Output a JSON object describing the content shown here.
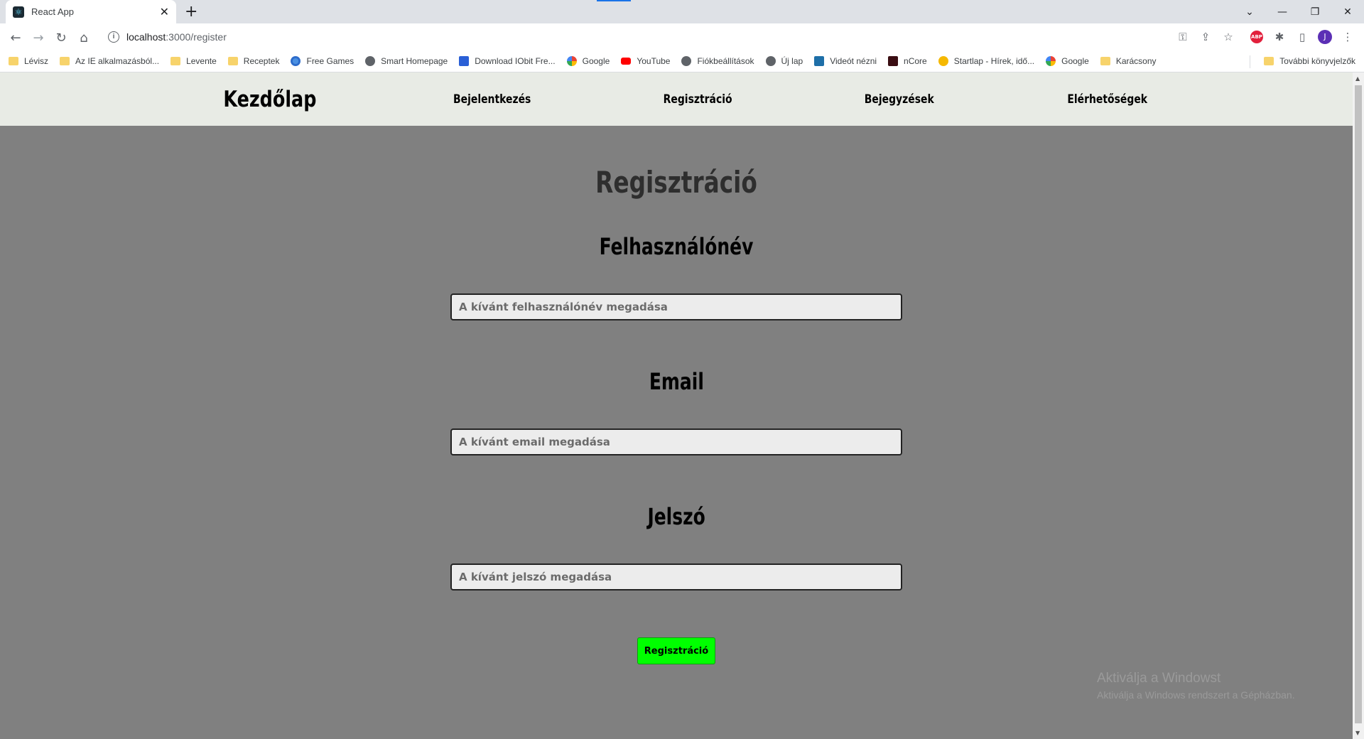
{
  "browser": {
    "tab": {
      "title": "React App",
      "close": "✕"
    },
    "new_tab": "+",
    "url_host": "localhost",
    "url_path": ":3000/register",
    "window_controls": {
      "dropdown": "⌄",
      "minimize": "—",
      "restore": "❐",
      "close": "✕"
    },
    "bookmarks": [
      {
        "label": "Lévisz",
        "icon": "folder-icon"
      },
      {
        "label": "Az IE alkalmazásból...",
        "icon": "folder-icon"
      },
      {
        "label": "Levente",
        "icon": "folder-icon"
      },
      {
        "label": "Receptek",
        "icon": "folder-icon"
      },
      {
        "label": "Free Games",
        "icon": "firefox-icon"
      },
      {
        "label": "Smart Homepage",
        "icon": "globe-icon"
      },
      {
        "label": "Download IObit Fre...",
        "icon": "iobit-icon"
      },
      {
        "label": "Google",
        "icon": "google-icon"
      },
      {
        "label": "YouTube",
        "icon": "youtube-icon"
      },
      {
        "label": "Fiókbeállítások",
        "icon": "globe-icon"
      },
      {
        "label": "Új lap",
        "icon": "globe-icon"
      },
      {
        "label": "Videót nézni",
        "icon": "y-icon"
      },
      {
        "label": "nCore",
        "icon": "ncore-icon"
      },
      {
        "label": "Startlap - Hírek, idő...",
        "icon": "startlap-icon"
      },
      {
        "label": "Google",
        "icon": "google-icon"
      },
      {
        "label": "Karácsony",
        "icon": "folder-icon"
      }
    ],
    "other_bookmarks": "További könyvjelzők"
  },
  "nav": {
    "home": "Kezdőlap",
    "login": "Bejelentkezés",
    "register": "Regisztráció",
    "posts": "Bejegyzések",
    "contacts": "Elérhetőségek"
  },
  "form": {
    "title": "Regisztráció",
    "username_label": "Felhasználónév",
    "username_placeholder": "A kívánt felhasználónév megadása",
    "email_label": "Email",
    "email_placeholder": "A kívánt email megadása",
    "password_label": "Jelszó",
    "password_placeholder": "A kívánt jelszó megadása",
    "submit_label": "Regisztráció",
    "submit_color": "#00ff00"
  },
  "watermark": {
    "line1": "Aktiválja a Windowst",
    "line2": "Aktiválja a Windows rendszert a Gépházban."
  }
}
